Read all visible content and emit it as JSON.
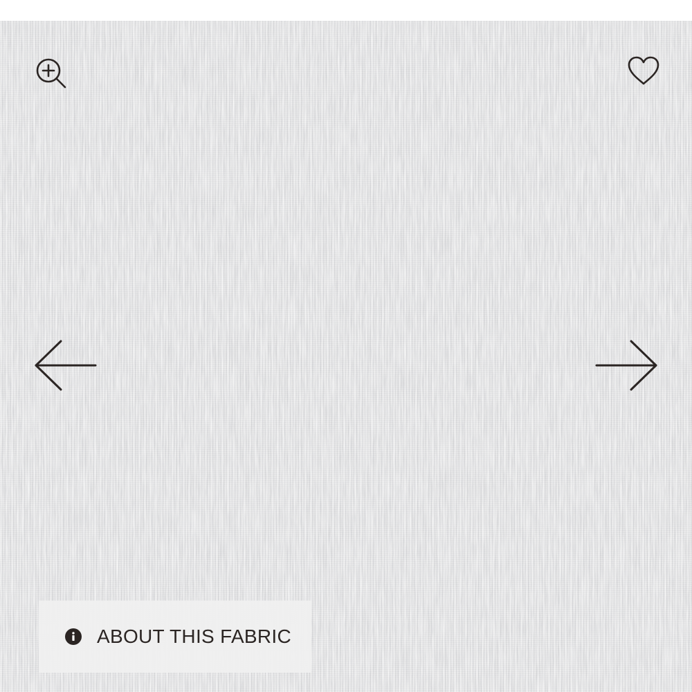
{
  "viewer": {
    "image_description_icon": "fabric-swatch",
    "controls": {
      "zoom_icon": "zoom-in-icon",
      "favorite_icon": "heart-icon",
      "prev_icon": "arrow-left-icon",
      "next_icon": "arrow-right-icon"
    },
    "about_fabric": {
      "icon": "info-icon",
      "label": "ABOUT THIS FABRIC"
    }
  },
  "colors": {
    "icon_stroke": "#2b2523",
    "fabric_base": "#e3e3e4",
    "panel_background": "#efefef"
  }
}
